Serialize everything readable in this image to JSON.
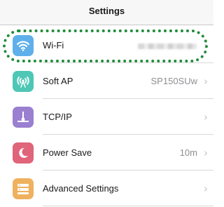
{
  "header": {
    "title": "Settings"
  },
  "rows": [
    {
      "label": "Wi-Fi",
      "value": "",
      "icon": "wifi-icon",
      "color": "#5fb0ea"
    },
    {
      "label": "Soft AP",
      "value": "SP150SUw",
      "icon": "soft-ap-icon",
      "color": "#4fc7b6"
    },
    {
      "label": "TCP/IP",
      "value": "",
      "icon": "tcp-ip-icon",
      "color": "#9b7fd0"
    },
    {
      "label": "Power Save",
      "value": "10m",
      "icon": "moon-icon",
      "color": "#e0647a"
    },
    {
      "label": "Advanced Settings",
      "value": "",
      "icon": "settings-list-icon",
      "color": "#efb15f"
    }
  ],
  "chevron": "›",
  "annotation": {
    "color": "#1f8c3a"
  }
}
